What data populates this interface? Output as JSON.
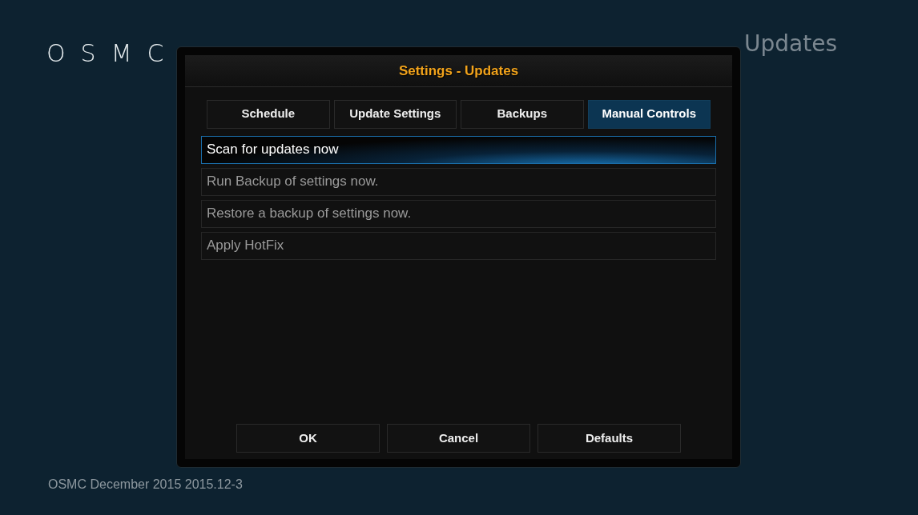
{
  "logo": "OSMC",
  "heading": "Updates",
  "dialog": {
    "title": "Settings - Updates",
    "tabs": [
      {
        "label": "Schedule",
        "selected": false
      },
      {
        "label": "Update Settings",
        "selected": false
      },
      {
        "label": "Backups",
        "selected": false
      },
      {
        "label": "Manual Controls",
        "selected": true
      }
    ],
    "items": [
      {
        "label": "Scan for updates now",
        "selected": true
      },
      {
        "label": "Run Backup of settings now.",
        "selected": false
      },
      {
        "label": "Restore a backup of settings now.",
        "selected": false
      },
      {
        "label": "Apply HotFix",
        "selected": false
      }
    ],
    "buttons": [
      "OK",
      "Cancel",
      "Defaults"
    ]
  },
  "footer": "OSMC December 2015 2015.12-3"
}
